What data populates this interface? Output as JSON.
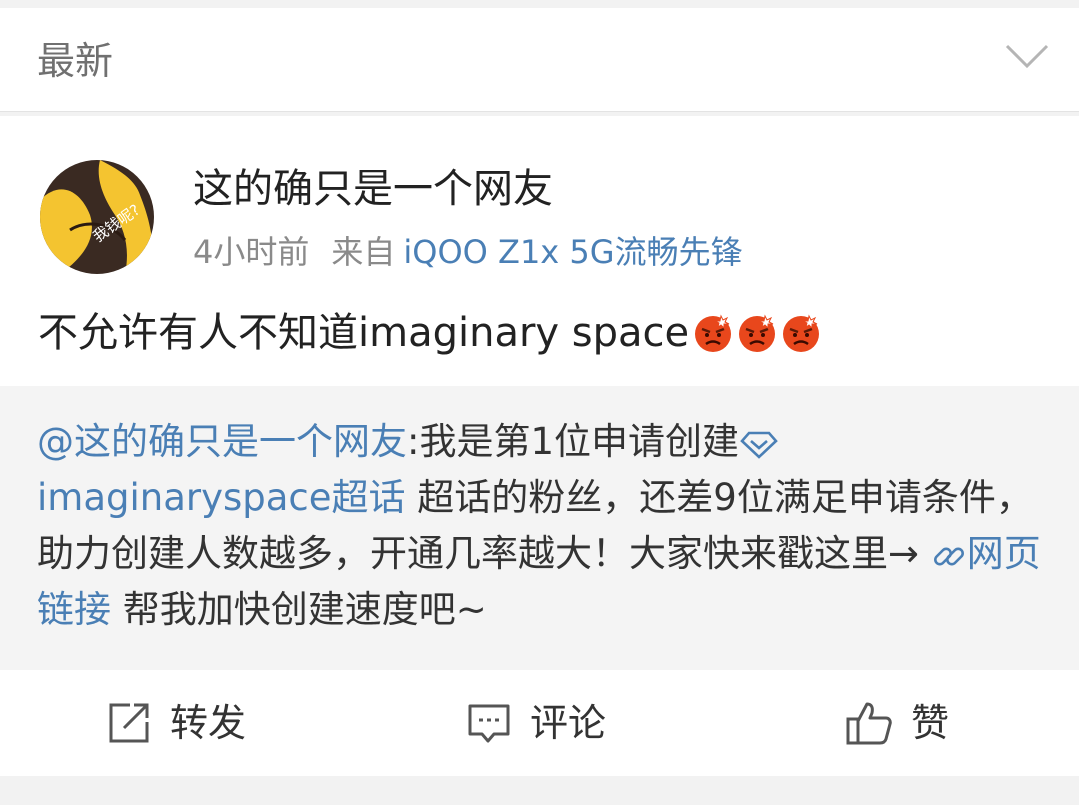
{
  "sort_header": {
    "label": "最新",
    "chevron_icon": "chevron-down-icon"
  },
  "post": {
    "avatar": {
      "text": "我钱呢?",
      "colors": {
        "bg": "#3a2a22",
        "fill": "#f4c430"
      }
    },
    "username": "这的确只是一个网友",
    "time": "4小时前",
    "from_prefix": "来自",
    "device": "iQOO Z1x 5G流畅先锋",
    "text": "不允许有人不知道imaginary space",
    "emojis": [
      "angry-face-icon",
      "angry-face-icon",
      "angry-face-icon"
    ]
  },
  "repost": {
    "mention": "@这的确只是一个网友",
    "text_1": ":我是第1位申请创建",
    "topic": "imaginaryspace超话",
    "text_2": " 超话的粉丝，还差9位满足申请条件，助力创建人数越多，开通几率越大！大家快来戳这里→ ",
    "link_label": "网页链接",
    "text_3": " 帮我加快创建速度吧~"
  },
  "actions": {
    "repost_label": "转发",
    "comment_label": "评论",
    "like_label": "赞"
  },
  "colors": {
    "link": "#4a7fb5",
    "text": "#222222",
    "muted": "#8a8a8a",
    "repost_bg": "#f4f4f4"
  }
}
